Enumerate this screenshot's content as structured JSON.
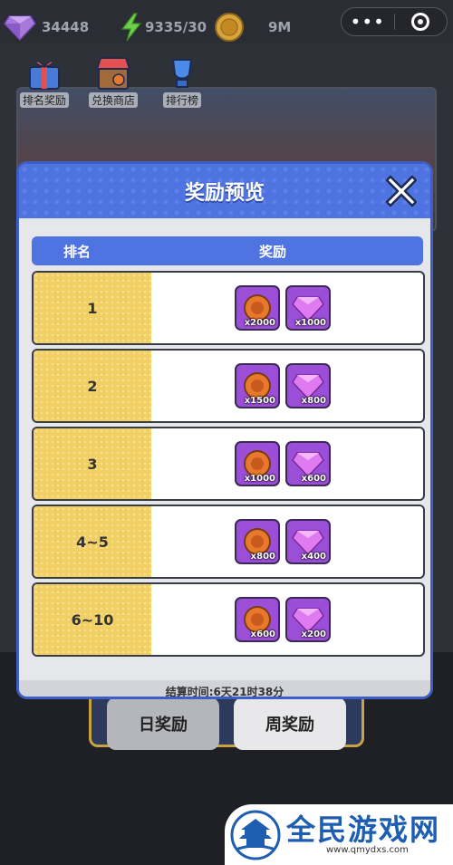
{
  "topbar": {
    "gems": "34448",
    "energy": "9335/30",
    "coins": "9M",
    "menu_label": "•••"
  },
  "scene": {
    "icons": [
      {
        "label": "排名奖励",
        "icon": "gift-icon"
      },
      {
        "label": "兑换商店",
        "icon": "shop-icon"
      },
      {
        "label": "排行榜",
        "icon": "trophy-icon"
      }
    ],
    "tabs": {
      "day": "日奖励",
      "week": "周奖励"
    }
  },
  "modal": {
    "title": "奖励预览",
    "col_rank": "排名",
    "col_reward": "奖励",
    "rows": [
      {
        "rank": "1",
        "coin": "x2000",
        "gem": "x1000"
      },
      {
        "rank": "2",
        "coin": "x1500",
        "gem": "x800"
      },
      {
        "rank": "3",
        "coin": "x1000",
        "gem": "x600"
      },
      {
        "rank": "4~5",
        "coin": "x800",
        "gem": "x400"
      },
      {
        "rank": "6~10",
        "coin": "x600",
        "gem": "x200"
      },
      {
        "rank": "",
        "coin": "",
        "gem": ""
      }
    ],
    "settle_time": "结算时间:6天21时38分"
  },
  "watermark": {
    "name": "全民游戏网",
    "url": "www.qmydxs.com"
  },
  "colors": {
    "header_blue": "#4f73e0",
    "rank_yellow": "#f2cf63",
    "item_purple": "#9b4fd8",
    "coin_orange": "#e8782c"
  }
}
